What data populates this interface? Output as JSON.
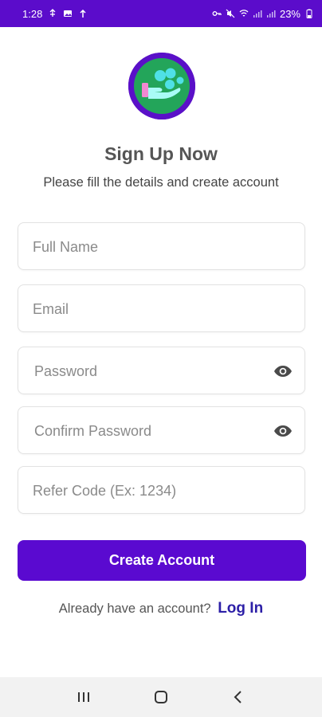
{
  "status_bar": {
    "time": "1:28",
    "battery": "23%"
  },
  "header": {
    "title": "Sign Up Now",
    "subtitle": "Please fill the details and create account"
  },
  "form": {
    "full_name": {
      "placeholder": "Full Name",
      "value": ""
    },
    "email": {
      "placeholder": "Email",
      "value": ""
    },
    "password": {
      "placeholder": "Password",
      "value": ""
    },
    "confirm_password": {
      "placeholder": "Confirm Password",
      "value": ""
    },
    "refer_code": {
      "placeholder": "Refer Code (Ex: 1234)",
      "value": ""
    },
    "submit_label": "Create Account"
  },
  "footer": {
    "prompt": "Already have an account?",
    "login_label": "Log In"
  },
  "icons": {
    "logo": "app-logo-hand-coins",
    "password_toggle": "eye-icon",
    "nav": [
      "recent-apps-icon",
      "home-icon",
      "back-icon"
    ]
  },
  "colors": {
    "primary": "#5a0ad0",
    "status_bar": "#5b0ccb",
    "link": "#2c1fa7",
    "logo_green": "#23a55a",
    "logo_cyan": "#4fe0e6"
  }
}
